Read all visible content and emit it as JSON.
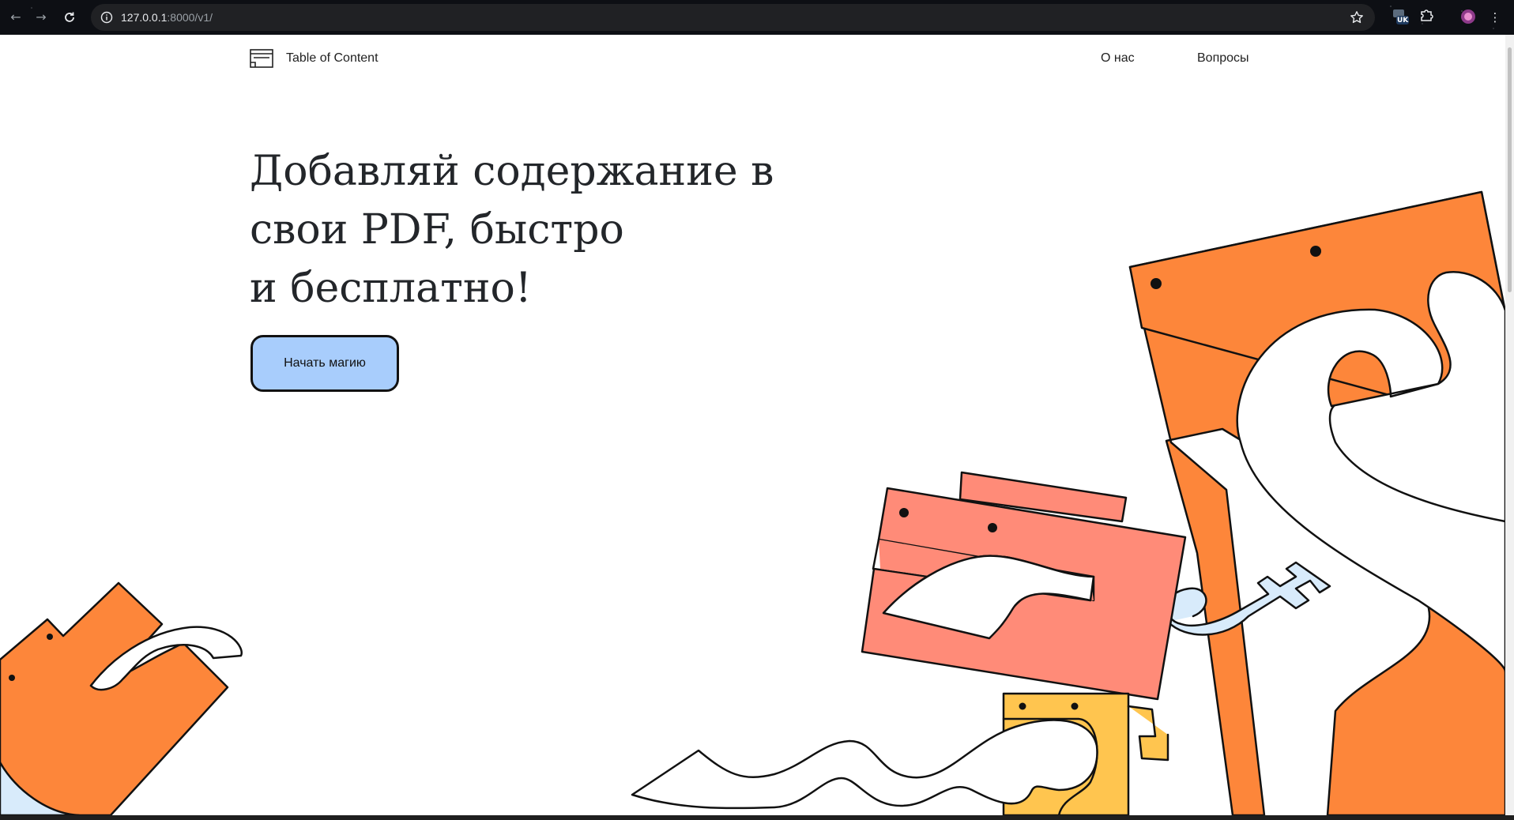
{
  "browser": {
    "url_host": "127.0.0.1",
    "url_path": ":8000/v1/",
    "extension_badge": "UK"
  },
  "header": {
    "brand": "Table of Content",
    "nav": [
      {
        "label": "О нас"
      },
      {
        "label": "Вопросы"
      }
    ]
  },
  "hero": {
    "title_lines": [
      "Добавляй содержание в",
      "свои PDF, быстро",
      "и бесплатно!"
    ],
    "cta_label": "Начать магию"
  },
  "colors": {
    "orange": "#fd863a",
    "salmon": "#ff8b78",
    "yellow": "#ffc54f",
    "cta_blue": "#a8cdfc",
    "light_blue": "#d8ebfb"
  }
}
